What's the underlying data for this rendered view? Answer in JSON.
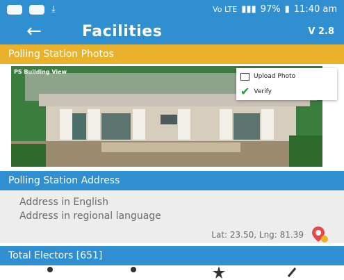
{
  "status_bar": {
    "signal_text": "Vo LTE",
    "battery": "97%",
    "time": "11:40 am"
  },
  "app_bar": {
    "title": "Facilities",
    "version": "V 2.8"
  },
  "photos_section": {
    "header": "Polling Station Photos",
    "photo_label": "PS Building View",
    "menu": {
      "upload_label": "Upload Photo",
      "verify_label": "Verify"
    }
  },
  "address_section": {
    "header": "Polling Station Address",
    "address_english": "Address in English",
    "address_regional": "Address in regional language",
    "coordinates": "Lat: 23.50, Lng: 81.39"
  },
  "electors_section": {
    "header": "Total Electors [651]"
  },
  "colors": {
    "primary": "#2f8fd0",
    "accent": "#eab22a",
    "address_bg": "#ededed",
    "pin": "#e44a4a"
  },
  "icons": [
    "back-arrow-icon",
    "upload-photo-icon",
    "check-icon",
    "location-pin-icon",
    "male-icon",
    "female-icon",
    "star-icon",
    "other-icon"
  ]
}
